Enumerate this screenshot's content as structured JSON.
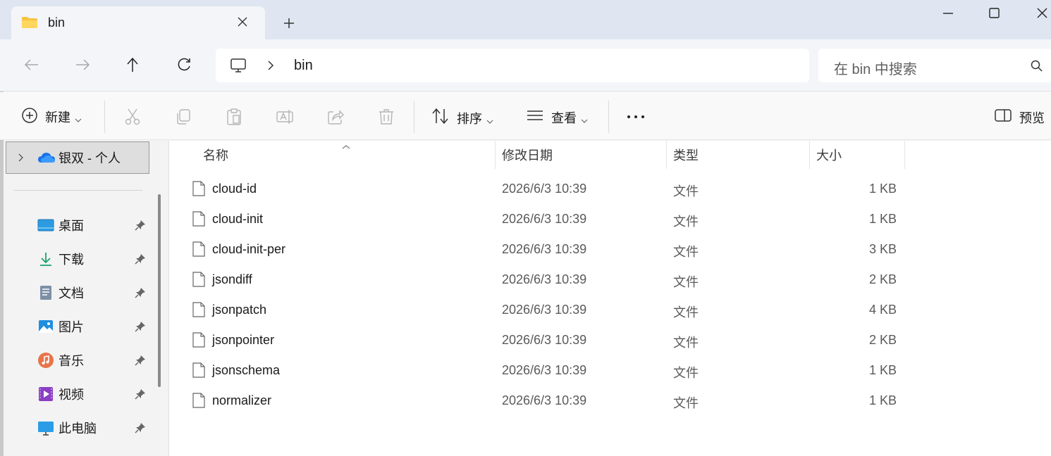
{
  "tab": {
    "title": "bin",
    "close_icon": "close-icon",
    "new_tab_icon": "plus-icon"
  },
  "window": {
    "minimize_icon": "minimize-icon",
    "maximize_icon": "maximize-icon",
    "close_icon": "close-icon"
  },
  "nav": {
    "back_icon": "arrow-left-icon",
    "forward_icon": "arrow-right-icon",
    "up_icon": "arrow-up-icon",
    "refresh_icon": "refresh-icon",
    "address_segments": [
      "bin"
    ],
    "search_placeholder": "在 bin 中搜索"
  },
  "toolbar": {
    "new_label": "新建",
    "sort_label": "排序",
    "view_label": "查看",
    "preview_label": "预览"
  },
  "sidebar": {
    "onedrive_label": "银双 - 个人",
    "items": [
      {
        "label": "桌面",
        "icon": "desktop-icon"
      },
      {
        "label": "下载",
        "icon": "download-icon"
      },
      {
        "label": "文档",
        "icon": "document-icon"
      },
      {
        "label": "图片",
        "icon": "pictures-icon"
      },
      {
        "label": "音乐",
        "icon": "music-icon"
      },
      {
        "label": "视频",
        "icon": "video-icon"
      },
      {
        "label": "此电脑",
        "icon": "computer-icon"
      }
    ]
  },
  "columns": {
    "name": "名称",
    "modified": "修改日期",
    "type": "类型",
    "size": "大小"
  },
  "files": [
    {
      "name": "cloud-id",
      "modified": "2026/6/3 10:39",
      "type": "文件",
      "size": "1 KB"
    },
    {
      "name": "cloud-init",
      "modified": "2026/6/3 10:39",
      "type": "文件",
      "size": "1 KB"
    },
    {
      "name": "cloud-init-per",
      "modified": "2026/6/3 10:39",
      "type": "文件",
      "size": "3 KB"
    },
    {
      "name": "jsondiff",
      "modified": "2026/6/3 10:39",
      "type": "文件",
      "size": "2 KB"
    },
    {
      "name": "jsonpatch",
      "modified": "2026/6/3 10:39",
      "type": "文件",
      "size": "4 KB"
    },
    {
      "name": "jsonpointer",
      "modified": "2026/6/3 10:39",
      "type": "文件",
      "size": "2 KB"
    },
    {
      "name": "jsonschema",
      "modified": "2026/6/3 10:39",
      "type": "文件",
      "size": "1 KB"
    },
    {
      "name": "normalizer",
      "modified": "2026/6/3 10:39",
      "type": "文件",
      "size": "1 KB"
    }
  ]
}
